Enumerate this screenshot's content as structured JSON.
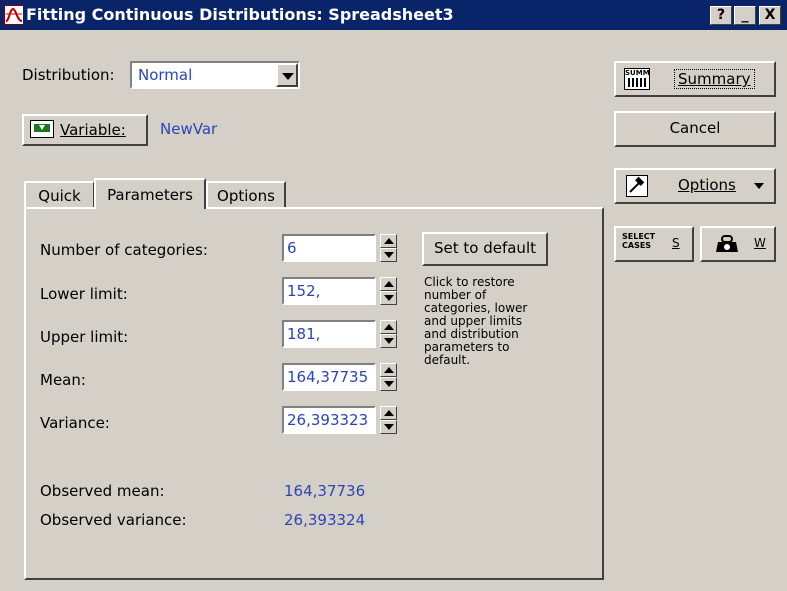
{
  "window": {
    "title": "Fitting Continuous Distributions: Spreadsheet3",
    "help_btn": "?",
    "min_btn": "_",
    "close_btn": "X"
  },
  "distribution": {
    "label": "Distribution:",
    "value": "Normal"
  },
  "variable": {
    "button_label": "Variable:",
    "value": "NewVar"
  },
  "tabs": [
    {
      "label": "Quick",
      "active": false
    },
    {
      "label": "Parameters",
      "active": true
    },
    {
      "label": "Options",
      "active": false
    }
  ],
  "params": {
    "categories": {
      "label": "Number of categories:",
      "value": "6"
    },
    "lower": {
      "label": "Lower limit:",
      "value": "152,"
    },
    "upper": {
      "label": "Upper limit:",
      "value": "181,"
    },
    "mean": {
      "label": "Mean:",
      "value": "164,37735"
    },
    "variance": {
      "label": "Variance:",
      "value": "26,393323"
    },
    "default_button": "Set to default",
    "default_hint": "Click to restore number of categories, lower and upper limits and distribution parameters to default."
  },
  "observed": {
    "mean_label": "Observed mean:",
    "mean_value": "164,37736",
    "variance_label": "Observed variance:",
    "variance_value": "26,393324"
  },
  "side": {
    "summary": "Summary",
    "summary_icon_text": "SUMM",
    "cancel": "Cancel",
    "options": "Options",
    "select_cases_icon": "SELECT CASES",
    "select_cases_key": "S",
    "weight_key": "W"
  },
  "colors": {
    "titlebar": "#0a246a",
    "face": "#d4d0c8",
    "value_text": "#2b45b8"
  }
}
